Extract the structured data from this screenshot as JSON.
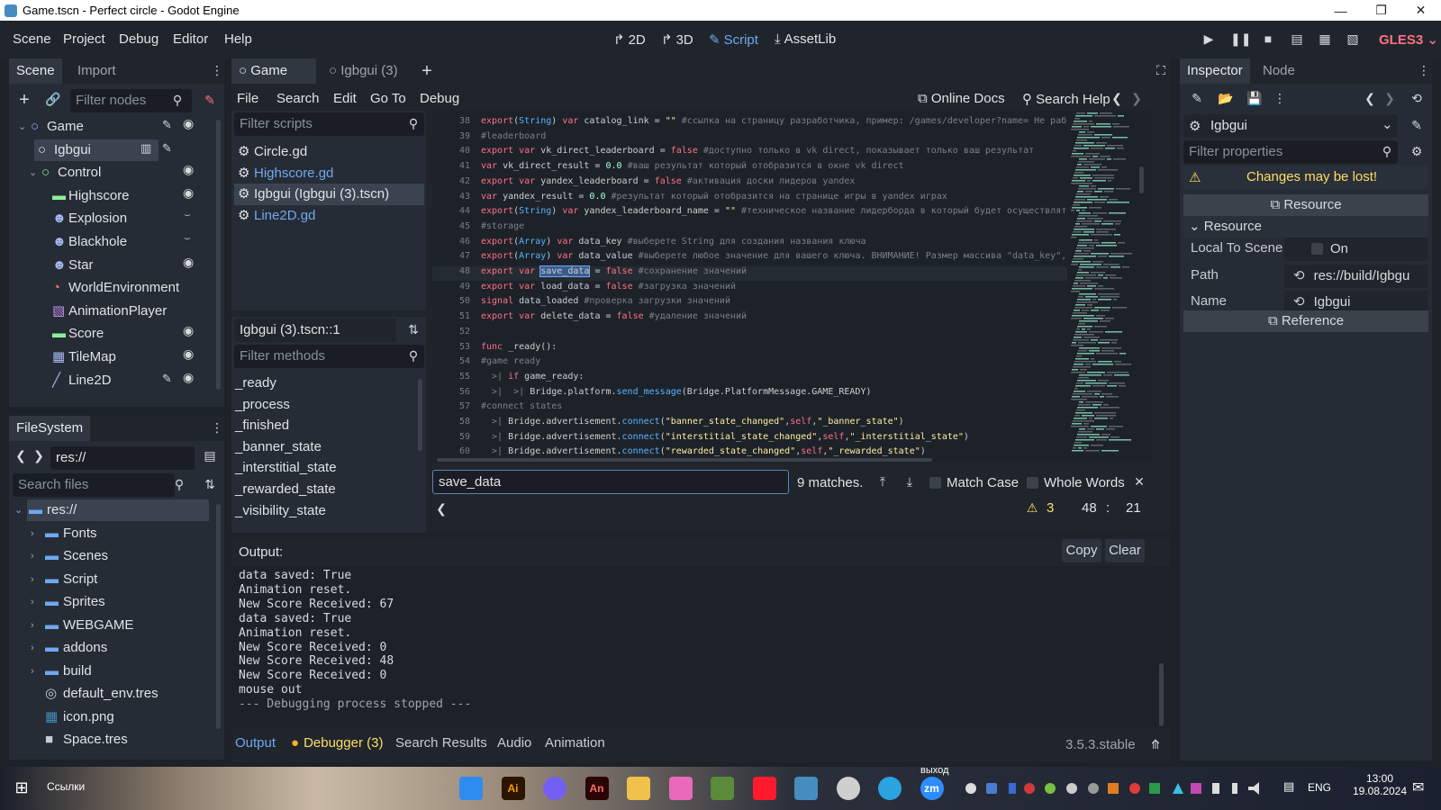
{
  "window": {
    "title": "Game.tscn - Perfect circle - Godot Engine",
    "minimize": "—",
    "maximize": "❐",
    "close": "✕"
  },
  "menu": {
    "items": [
      "Scene",
      "Project",
      "Debug",
      "Editor",
      "Help"
    ],
    "main_screens": [
      "2D",
      "3D",
      "Script",
      "AssetLib"
    ],
    "renderer": "GLES3"
  },
  "scene_dock": {
    "tabs": [
      "Scene",
      "Import"
    ],
    "filter_placeholder": "Filter nodes",
    "nodes": [
      {
        "name": "Game",
        "depth": 0,
        "icon_color": "#8eb8ff",
        "visible": true
      },
      {
        "name": "Igbgui",
        "depth": 1,
        "icon_color": "#e0e2e6",
        "visible": false
      },
      {
        "name": "Control",
        "depth": 1,
        "icon_color": "#8eef97",
        "visible": true
      },
      {
        "name": "Highscore",
        "depth": 2,
        "icon_color": "#8eef97",
        "visible": true
      },
      {
        "name": "Explosion",
        "depth": 2,
        "icon_color": "#a5b7f3",
        "visible": false
      },
      {
        "name": "Blackhole",
        "depth": 2,
        "icon_color": "#a5b7f3",
        "visible": false
      },
      {
        "name": "Star",
        "depth": 2,
        "icon_color": "#a5b7f3",
        "visible": true
      },
      {
        "name": "WorldEnvironment",
        "depth": 2,
        "icon_color": "#ff7085",
        "visible": false
      },
      {
        "name": "AnimationPlayer",
        "depth": 2,
        "icon_color": "#c38ef1",
        "visible": false
      },
      {
        "name": "Score",
        "depth": 2,
        "icon_color": "#8eef97",
        "visible": true
      },
      {
        "name": "TileMap",
        "depth": 2,
        "icon_color": "#a5b7f3",
        "visible": true
      },
      {
        "name": "Line2D",
        "depth": 2,
        "icon_color": "#a5b7f3",
        "visible": true
      }
    ]
  },
  "filesystem": {
    "tab": "FileSystem",
    "path": "res://",
    "search_placeholder": "Search files",
    "items": [
      {
        "name": "res://",
        "type": "root"
      },
      {
        "name": "Fonts",
        "type": "folder"
      },
      {
        "name": "Scenes",
        "type": "folder"
      },
      {
        "name": "Script",
        "type": "folder"
      },
      {
        "name": "Sprites",
        "type": "folder"
      },
      {
        "name": "WEBGAME",
        "type": "folder"
      },
      {
        "name": "addons",
        "type": "folder"
      },
      {
        "name": "build",
        "type": "folder"
      },
      {
        "name": "default_env.tres",
        "type": "file"
      },
      {
        "name": "icon.png",
        "type": "file"
      },
      {
        "name": "Space.tres",
        "type": "file"
      }
    ]
  },
  "editor_tabs": {
    "tabs": [
      "Game",
      "Igbgui (3)"
    ],
    "active": "Game"
  },
  "script_menu": {
    "items": [
      "File",
      "Search",
      "Edit",
      "Go To",
      "Debug"
    ],
    "online_docs": "Online Docs",
    "search_help": "Search Help"
  },
  "script_list": {
    "filter_placeholder": "Filter scripts",
    "scripts": [
      {
        "name": "Circle.gd",
        "selected": false,
        "color": "#e0e2e6"
      },
      {
        "name": "Highscore.gd",
        "selected": false,
        "color": "#6fa8f0"
      },
      {
        "name": "Igbgui (Igbgui (3).tscn)",
        "selected": true,
        "color": "#e0e2e6"
      },
      {
        "name": "Line2D.gd",
        "selected": false,
        "color": "#6fa8f0"
      }
    ],
    "current": "Igbgui (3).tscn::1",
    "methods_placeholder": "Filter methods",
    "methods": [
      "_ready",
      "_process",
      "_finished",
      "_banner_state",
      "_interstitial_state",
      "_rewarded_state",
      "_visibility_state"
    ]
  },
  "code": {
    "lines": [
      {
        "n": "38",
        "t": [
          [
            "kw",
            "export"
          ],
          [
            "plain",
            "("
          ],
          [
            "fn",
            "String"
          ],
          [
            "plain",
            ") "
          ],
          [
            "kw",
            "var"
          ],
          [
            "plain",
            " catalog_link = "
          ],
          [
            "str",
            "\"\""
          ],
          [
            "com",
            " #ссылка на страницу разработчика, пример: /games/developer?name= Не раб"
          ]
        ]
      },
      {
        "n": "39",
        "t": [
          [
            "com",
            "#leaderboard"
          ]
        ]
      },
      {
        "n": "40",
        "t": [
          [
            "kw",
            "export var"
          ],
          [
            "plain",
            " vk_direct_leaderboard = "
          ],
          [
            "kw",
            "false"
          ],
          [
            "com",
            " #доступно только в vk direct, показывает только ваш результат"
          ]
        ]
      },
      {
        "n": "41",
        "t": [
          [
            "kw",
            "var"
          ],
          [
            "plain",
            " vk_direct_result = "
          ],
          [
            "num",
            "0.0"
          ],
          [
            "com",
            " #ваш результат который отобразится в окне vk direct"
          ]
        ]
      },
      {
        "n": "42",
        "t": [
          [
            "kw",
            "export var"
          ],
          [
            "plain",
            " yandex_leaderboard = "
          ],
          [
            "kw",
            "false"
          ],
          [
            "com",
            " #активация доски лидеров yandex"
          ]
        ]
      },
      {
        "n": "43",
        "t": [
          [
            "kw",
            "var"
          ],
          [
            "plain",
            " yandex_result = "
          ],
          [
            "num",
            "0.0"
          ],
          [
            "com",
            " #результат который отобразится на странице игры в yandex играх"
          ]
        ]
      },
      {
        "n": "44",
        "t": [
          [
            "kw",
            "export"
          ],
          [
            "plain",
            "("
          ],
          [
            "fn",
            "String"
          ],
          [
            "plain",
            ") "
          ],
          [
            "kw",
            "var"
          ],
          [
            "plain",
            " yandex_leaderboard_name = "
          ],
          [
            "str",
            "\"\""
          ],
          [
            "com",
            " #техническое название лидерборда в который будет осуществлят"
          ]
        ]
      },
      {
        "n": "45",
        "t": [
          [
            "com",
            "#storage"
          ]
        ]
      },
      {
        "n": "46",
        "t": [
          [
            "kw",
            "export"
          ],
          [
            "plain",
            "("
          ],
          [
            "fn",
            "Array"
          ],
          [
            "plain",
            ") "
          ],
          [
            "kw",
            "var"
          ],
          [
            "plain",
            " data_key "
          ],
          [
            "com",
            "#выберете String для создания названия ключа"
          ]
        ]
      },
      {
        "n": "47",
        "t": [
          [
            "kw",
            "export"
          ],
          [
            "plain",
            "("
          ],
          [
            "fn",
            "Array"
          ],
          [
            "plain",
            ") "
          ],
          [
            "kw",
            "var"
          ],
          [
            "plain",
            " data_value "
          ],
          [
            "com",
            "#выберете любое значение для вашего ключа. ВНИМАНИЕ! Размер массива \"data_key\","
          ]
        ]
      },
      {
        "n": "48",
        "t": [
          [
            "kw",
            "export var"
          ],
          [
            "plain",
            " "
          ],
          [
            "sel",
            "save_data"
          ],
          [
            "plain",
            " = "
          ],
          [
            "kw",
            "false"
          ],
          [
            "com",
            " #сохранение значений"
          ]
        ]
      },
      {
        "n": "49",
        "t": [
          [
            "kw",
            "export var"
          ],
          [
            "plain",
            " load_data = "
          ],
          [
            "kw",
            "false"
          ],
          [
            "com",
            " #загрузка значений"
          ]
        ]
      },
      {
        "n": "50",
        "t": [
          [
            "kw",
            "signal"
          ],
          [
            "plain",
            " data_loaded "
          ],
          [
            "com",
            "#проверка загрузки значений"
          ]
        ]
      },
      {
        "n": "51",
        "t": [
          [
            "kw",
            "export var"
          ],
          [
            "plain",
            " delete_data = "
          ],
          [
            "kw",
            "false"
          ],
          [
            "com",
            " #удаление значений"
          ]
        ]
      },
      {
        "n": "52",
        "t": []
      },
      {
        "n": "53",
        "t": [
          [
            "kw",
            "func"
          ],
          [
            "plain",
            " _ready():"
          ]
        ]
      },
      {
        "n": "54",
        "t": [
          [
            "com",
            "#game ready"
          ]
        ]
      },
      {
        "n": "55",
        "t": [
          [
            "com",
            "  >| "
          ],
          [
            "kw",
            "if"
          ],
          [
            "plain",
            " game_ready:"
          ]
        ]
      },
      {
        "n": "56",
        "t": [
          [
            "com",
            "  >|  >| "
          ],
          [
            "plain",
            "Bridge.platform."
          ],
          [
            "fn",
            "send_message"
          ],
          [
            "plain",
            "(Bridge.PlatformMessage.GAME_READY)"
          ]
        ]
      },
      {
        "n": "57",
        "t": [
          [
            "com",
            "#connect states"
          ]
        ]
      },
      {
        "n": "58",
        "t": [
          [
            "com",
            "  >| "
          ],
          [
            "plain",
            "Bridge.advertisement."
          ],
          [
            "fn",
            "connect"
          ],
          [
            "plain",
            "("
          ],
          [
            "str",
            "\"banner_state_changed\""
          ],
          [
            "plain",
            ","
          ],
          [
            "kw",
            "self"
          ],
          [
            "plain",
            ","
          ],
          [
            "str",
            "\"_banner_state\""
          ],
          [
            "plain",
            ")"
          ]
        ]
      },
      {
        "n": "59",
        "t": [
          [
            "com",
            "  >| "
          ],
          [
            "plain",
            "Bridge.advertisement."
          ],
          [
            "fn",
            "connect"
          ],
          [
            "plain",
            "("
          ],
          [
            "str",
            "\"interstitial_state_changed\""
          ],
          [
            "plain",
            ","
          ],
          [
            "kw",
            "self"
          ],
          [
            "plain",
            ","
          ],
          [
            "str",
            "\"_interstitial_state\""
          ],
          [
            "plain",
            ")"
          ]
        ]
      },
      {
        "n": "60",
        "t": [
          [
            "com",
            "  >| "
          ],
          [
            "plain",
            "Bridge.advertisement."
          ],
          [
            "fn",
            "connect"
          ],
          [
            "plain",
            "("
          ],
          [
            "str",
            "\"rewarded_state_changed\""
          ],
          [
            "plain",
            ","
          ],
          [
            "kw",
            "self"
          ],
          [
            "plain",
            ","
          ],
          [
            "str",
            "\"_rewarded_state\""
          ],
          [
            "plain",
            ")"
          ]
        ]
      }
    ]
  },
  "find_bar": {
    "value": "save_data",
    "matches": "9 matches.",
    "match_case": "Match Case",
    "whole_words": "Whole Words",
    "warnings": "3",
    "line": "48",
    "colon": ":",
    "column": "21"
  },
  "output": {
    "title": "Output:",
    "copy": "Copy",
    "clear": "Clear",
    "lines": [
      "data saved: True",
      "Animation reset.",
      "New Score Received: 67",
      "data saved: True",
      "Animation reset.",
      "New Score Received: 0",
      "New Score Received: 48",
      "New Score Received: 0",
      "mouse out",
      "--- Debugging process stopped ---"
    ]
  },
  "bottom_tabs": {
    "tabs": [
      "Output",
      "Debugger (3)",
      "Search Results",
      "Audio",
      "Animation"
    ],
    "version": "3.5.3.stable"
  },
  "inspector": {
    "tabs": [
      "Inspector",
      "Node"
    ],
    "object": "Igbgui",
    "filter_placeholder": "Filter properties",
    "warning": "Changes may be lost!",
    "section_resource": "Resource",
    "group_resource": "Resource",
    "props": [
      {
        "label": "Local To Scene",
        "value": "On"
      },
      {
        "label": "Path",
        "value": "res://build/Igbgu"
      },
      {
        "label": "Name",
        "value": "Igbgui"
      }
    ],
    "section_reference": "Reference"
  },
  "taskbar": {
    "links": "Ссылки",
    "lang": "ENG",
    "time": "13:00",
    "date": "19.08.2024",
    "exit_label": "выход",
    "apps": [
      {
        "name": "app-1",
        "color": "#2e8cf0"
      },
      {
        "name": "illustrator",
        "color": "#ff9a00"
      },
      {
        "name": "viber",
        "color": "#7360f2"
      },
      {
        "name": "animate",
        "color": "#d83b3b"
      },
      {
        "name": "explorer",
        "color": "#f0c14b"
      },
      {
        "name": "paint",
        "color": "#e86ab8"
      },
      {
        "name": "minecraft",
        "color": "#5b8a3a"
      },
      {
        "name": "opera",
        "color": "#ff1b2d"
      },
      {
        "name": "godot",
        "color": "#478cbf"
      },
      {
        "name": "obs",
        "color": "#cfcfcf"
      },
      {
        "name": "telegram",
        "color": "#2aa3e0"
      },
      {
        "name": "zoom",
        "color": "#2d8cff"
      }
    ],
    "ai_label": "Ai",
    "an_label": "An",
    "zm_label": "zm"
  }
}
